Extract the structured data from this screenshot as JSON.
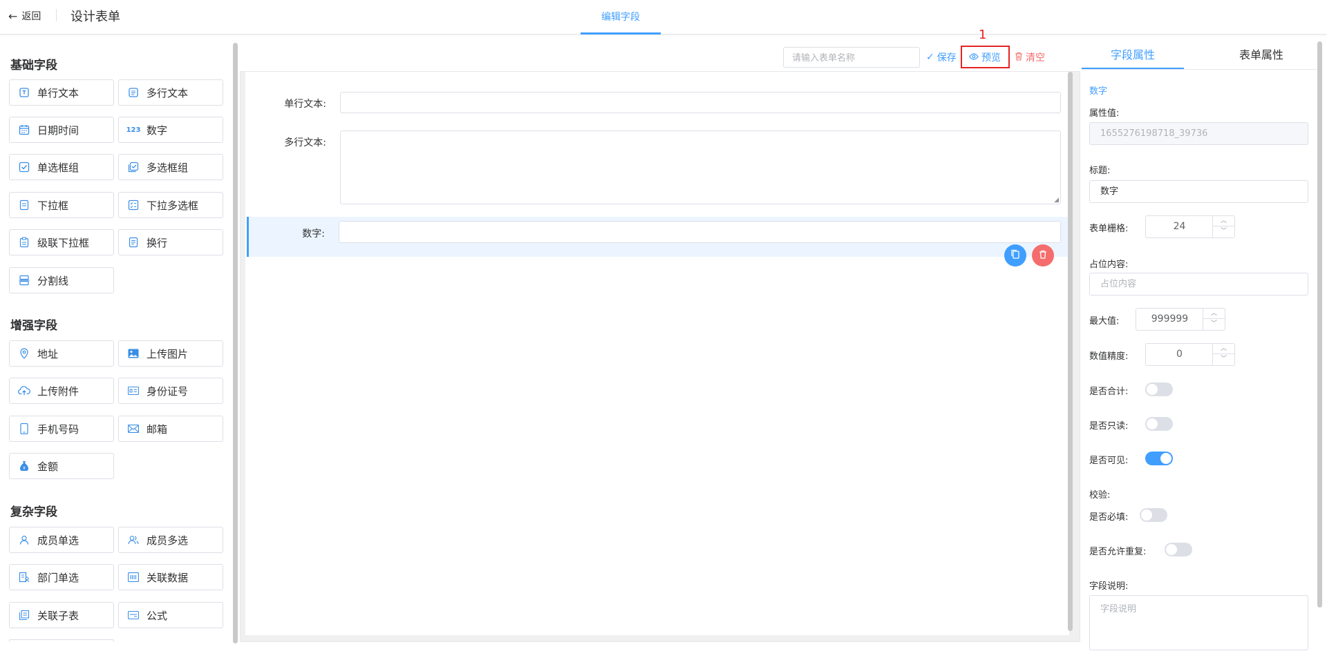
{
  "header": {
    "back_label": "返回",
    "title": "设计表单",
    "tab": "编辑字段"
  },
  "left": {
    "groups": [
      {
        "title": "基础字段"
      },
      {
        "title": "增强字段"
      },
      {
        "title": "复杂字段"
      }
    ],
    "basic": [
      "单行文本",
      "多行文本",
      "日期时间",
      "数字",
      "单选框组",
      "多选框组",
      "下拉框",
      "下拉多选框",
      "级联下拉框",
      "换行",
      "分割线"
    ],
    "enhanced": [
      "地址",
      "上传图片",
      "上传附件",
      "身份证号",
      "手机号码",
      "邮箱",
      "金额"
    ],
    "complex": [
      "成员单选",
      "成员多选",
      "部门单选",
      "关联数据",
      "关联子表",
      "公式"
    ]
  },
  "toolbar": {
    "name_placeholder": "请输入表单名称",
    "save": "保存",
    "preview": "预览",
    "clear": "清空",
    "marker": "1"
  },
  "canvas": {
    "fields": [
      {
        "label": "单行文本:"
      },
      {
        "label": "多行文本:"
      },
      {
        "label": "数字:"
      }
    ]
  },
  "right": {
    "tab_field": "字段属性",
    "tab_form": "表单属性",
    "field_type": "数字",
    "prop_value_label": "属性值:",
    "prop_value": "1655276198718_39736",
    "title_label": "标题:",
    "title_value": "数字",
    "grid_label": "表单栅格:",
    "grid_value": "24",
    "placeholder_label": "占位内容:",
    "placeholder_value": "占位内容",
    "max_label": "最大值:",
    "max_value": "999999",
    "precision_label": "数值精度:",
    "precision_value": "0",
    "sum_label": "是否合计:",
    "readonly_label": "是否只读:",
    "visible_label": "是否可见:",
    "validate_label": "校验:",
    "required_label": "是否必填:",
    "repeat_label": "是否允许重复:",
    "desc_label": "字段说明:",
    "desc_placeholder": "字段说明",
    "toggles": {
      "sum": false,
      "readonly": false,
      "visible": true,
      "required": false,
      "repeat": false
    }
  },
  "colors": {
    "accent": "#409eff",
    "danger": "#f56c6c",
    "highlight": "#e62222"
  }
}
